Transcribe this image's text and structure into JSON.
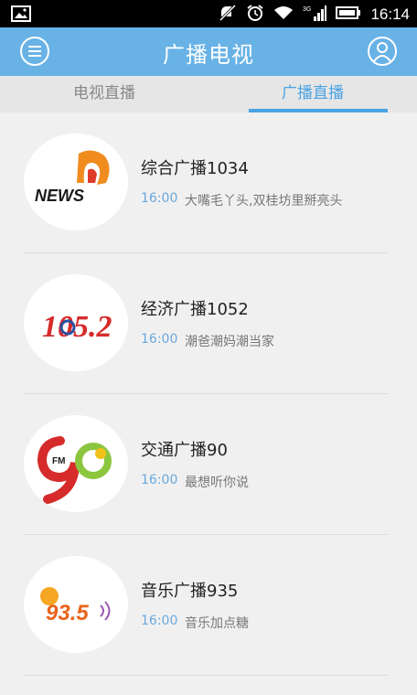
{
  "status_bar": {
    "time": "16:14",
    "network": "3G",
    "icons": [
      "picture-icon",
      "mute-icon",
      "alarm-icon",
      "wifi-icon",
      "signal-icon",
      "battery-icon"
    ]
  },
  "app_bar": {
    "title": "广播电视",
    "left_icon": "menu-icon",
    "right_icon": "user-icon"
  },
  "tabs": [
    {
      "label": "电视直播",
      "selected": false
    },
    {
      "label": "广播直播",
      "selected": true
    }
  ],
  "stations": [
    {
      "name": "综合广播1034",
      "time": "16:00",
      "program": "大嘴毛丫头,双桂坊里掰亮头",
      "logo": "news-logo",
      "logo_text": "NEWS"
    },
    {
      "name": "经济广播1052",
      "time": "16:00",
      "program": "潮爸潮妈潮当家",
      "logo": "105-2-logo",
      "logo_text": "105.2"
    },
    {
      "name": "交通广播90",
      "time": "16:00",
      "program": "最想听你说",
      "logo": "90fm-logo",
      "logo_text": "FM"
    },
    {
      "name": "音乐广播935",
      "time": "16:00",
      "program": "音乐加点糖",
      "logo": "935-logo",
      "logo_text": "93.5"
    }
  ],
  "colors": {
    "app_bar": "#68b2e6",
    "tab_active": "#4aa3e4",
    "time": "#6aa8de"
  }
}
